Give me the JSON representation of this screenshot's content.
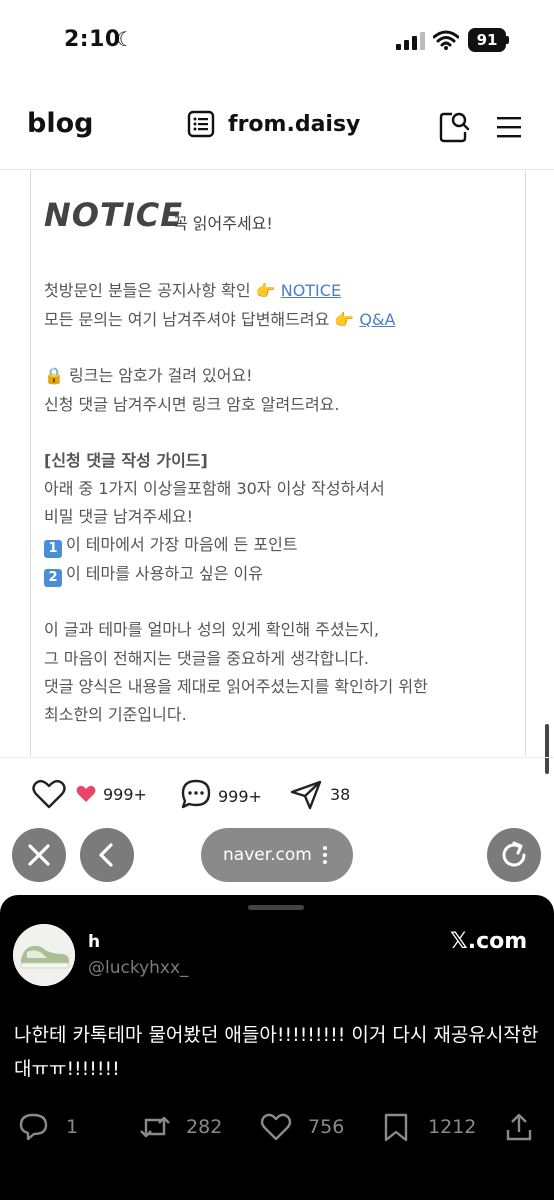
{
  "status_bar": {
    "time": "2:10",
    "battery": "91"
  },
  "header": {
    "brand": "blog",
    "blog_name": "from.daisy"
  },
  "notice": {
    "title": "NOTICE",
    "subtitle": "꼭 읽어주세요!",
    "lines": [
      {
        "text": "첫방문인 분들은 공지사항 확인 👉 ",
        "link": "NOTICE"
      },
      {
        "text": "모든 문의는 여기 남겨주셔야 답변해드려요 👉 ",
        "link": "Q&A"
      }
    ],
    "lock_line": "🔒 링크는 암호가 걸려 있어요!",
    "lock_line2": "신청 댓글 남겨주시면 링크 암호 알려드려요.",
    "guide_title": "[신청 댓글 작성 가이드]",
    "guide_1": "아래 중 1가지 이상을포함해 30자 이상 작성하셔서",
    "guide_2": "비밀 댓글 남겨주세요!",
    "item1_num": "1",
    "item1": "이 테마에서 가장 마음에 든 포인트",
    "item2_num": "2",
    "item2": "이 테마를 사용하고 싶은 이유",
    "para_1": "이 글과 테마를 얼마나 성의 있게 확인해 주셨는지,",
    "para_2": "그 마음이 전해지는 댓글을 중요하게 생각합니다.",
    "para_3": "댓글 양식은 내용을 제대로 읽어주셨는지를 확인하기 위한",
    "para_4": "최소한의 기준입니다."
  },
  "reactions": {
    "likes": "999+",
    "comments": "999+",
    "shares": "38"
  },
  "browser": {
    "url": "naver.com"
  },
  "tweet": {
    "name": "h",
    "username": "@luckyhxx_",
    "source": "𝕏.com",
    "text": "나한테 카톡테마 물어봤던 애들아!!!!!!!!! 이거 다시 재공유시작한대ㅠㅠ!!!!!!!",
    "replies": "1",
    "retweets": "282",
    "likes": "756",
    "bookmarks": "1212"
  }
}
